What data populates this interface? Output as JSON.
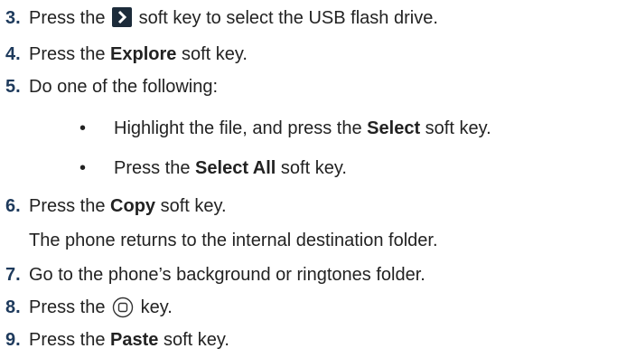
{
  "steps": [
    {
      "num": "3.",
      "pre": "Press the",
      "post": "soft key to select the USB flash drive."
    },
    {
      "num": "4.",
      "pre": "Press the",
      "bold": "Explore",
      "post": "soft key."
    },
    {
      "num": "5.",
      "text": "Do one of the following:"
    },
    {
      "num": "6.",
      "pre": "Press the",
      "bold": "Copy",
      "post": "soft key."
    },
    {
      "num": "7.",
      "text": "Go to the phone’s background or ringtones folder."
    },
    {
      "num": "8.",
      "pre": "Press the",
      "post": "key."
    },
    {
      "num": "9.",
      "pre": "Press the",
      "bold": "Paste",
      "post": "soft key."
    }
  ],
  "bullets": [
    {
      "symbol": "•",
      "pre": "Highlight the file, and press the",
      "bold": "Select",
      "post": "soft key."
    },
    {
      "symbol": "•",
      "pre": "Press the",
      "bold": "Select All",
      "post": "soft key."
    }
  ],
  "step6_note": "The phone returns to the internal destination folder.",
  "icons": {
    "step3": "right-arrow-softkey-icon",
    "step8": "home-square-key-icon"
  }
}
